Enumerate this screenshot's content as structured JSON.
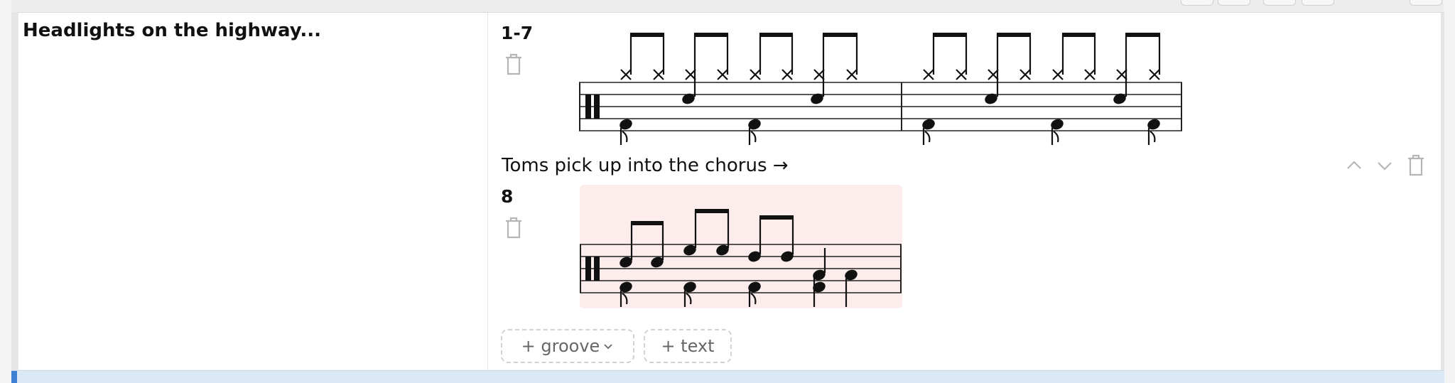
{
  "section": {
    "title": "Headlights on the highway..."
  },
  "groove1": {
    "measures": "1-7"
  },
  "note": {
    "text": "Toms pick up into the chorus →"
  },
  "groove2": {
    "measures": "8",
    "highlight_color": "#fcecec"
  },
  "actions": {
    "groove_label": "+ groove",
    "text_label": "+ text"
  },
  "icons": {
    "trash": "trash-icon",
    "move_up": "chevron-up-icon",
    "move_down": "chevron-down-icon",
    "expand": "chevron-down-icon"
  },
  "colors": {
    "accent": "#3d7fd0",
    "ink": "#111111"
  }
}
